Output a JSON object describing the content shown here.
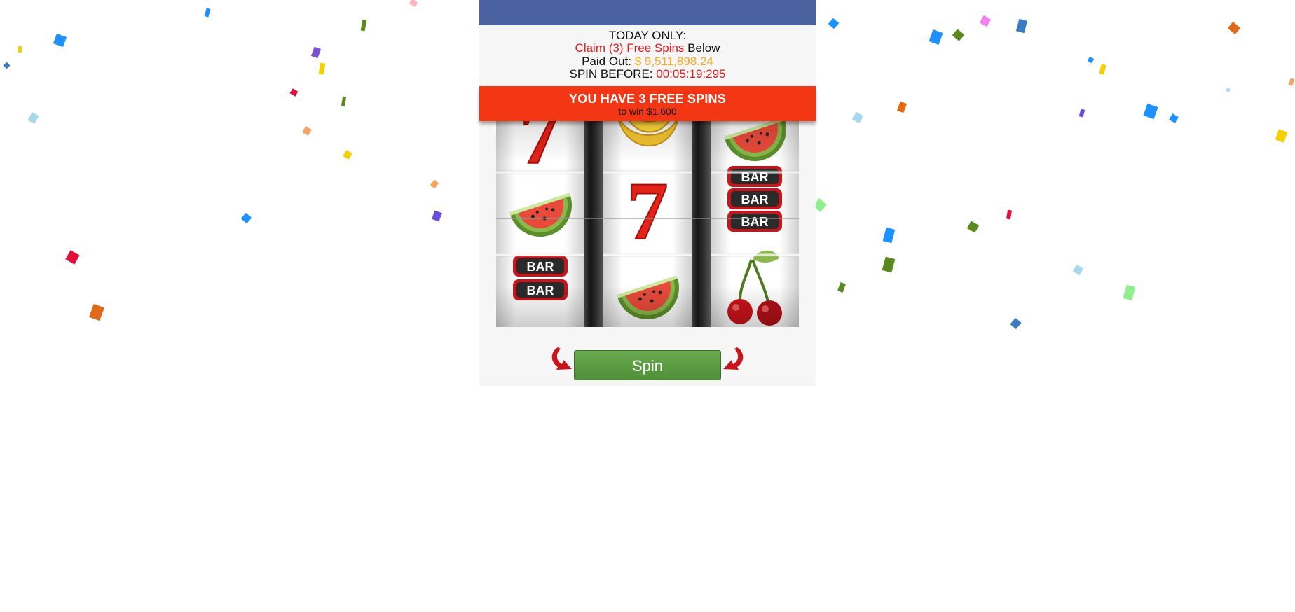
{
  "header": {
    "today_label": "TODAY ONLY:",
    "claim_highlight": "Claim (3) Free Spins",
    "claim_suffix": " Below",
    "paid_label": "Paid Out: ",
    "paid_amount": "$ 9,511,898.24",
    "spin_before_label": "SPIN BEFORE: ",
    "countdown": "00:05:19:295"
  },
  "banner": {
    "title": "YOU HAVE 3 FREE SPINS",
    "subtitle": "to win $1,600"
  },
  "reels": [
    {
      "symbols": [
        "seven",
        "watermelon",
        "bar-double"
      ]
    },
    {
      "symbols": [
        "banana",
        "seven",
        "watermelon"
      ]
    },
    {
      "symbols": [
        "watermelon",
        "bar-triple",
        "cherry"
      ]
    }
  ],
  "bar_text": "BAR",
  "seven_text": "7",
  "spin_button": {
    "label": "Spin"
  },
  "colors": {
    "topbar": "#4a63a0",
    "banner": "#f33715",
    "spin_button": "#5a9a40",
    "highlight_red": "#e61a1a",
    "highlight_orange": "#f5a820",
    "arrow_red": "#c8141a"
  }
}
